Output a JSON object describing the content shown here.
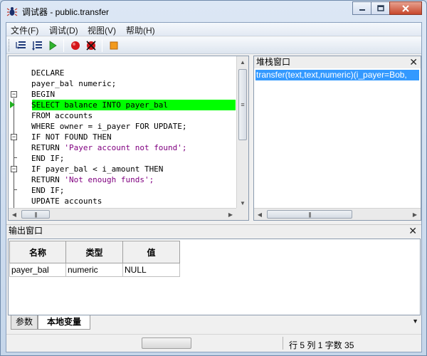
{
  "window": {
    "title": "调试器 - public.transfer",
    "minimize_icon": "minimize-icon",
    "maximize_icon": "maximize-icon",
    "close_icon": "close-icon"
  },
  "menu": [
    {
      "label": "文件(F)"
    },
    {
      "label": "调试(D)"
    },
    {
      "label": "视图(V)"
    },
    {
      "label": "帮助(H)"
    }
  ],
  "toolbar": [
    {
      "name": "step-into-icon"
    },
    {
      "name": "step-over-icon"
    },
    {
      "name": "continue-icon"
    },
    {
      "name": "set-breakpoint-icon"
    },
    {
      "name": "clear-breakpoints-icon"
    },
    {
      "name": "stop-icon"
    }
  ],
  "code": {
    "lines": [
      "DECLARE",
      "payer_bal numeric;",
      "BEGIN",
      "SELECT balance INTO payer_bal",
      "FROM accounts",
      "WHERE owner = i_payer FOR UPDATE;",
      "IF NOT FOUND THEN",
      "RETURN 'Payer account not found';",
      "END IF;",
      "IF payer_bal < i_amount THEN",
      "RETURN 'Not enough funds';",
      "END IF;",
      "UPDATE accounts"
    ],
    "current_line": 4
  },
  "stack": {
    "title": "堆栈窗口",
    "frames": [
      "transfer(text,text,numeric)(i_payer=Bob,"
    ]
  },
  "output": {
    "title": "输出窗口",
    "columns": [
      "名称",
      "类型",
      "值"
    ],
    "rows": [
      [
        "payer_bal",
        "numeric",
        "NULL"
      ]
    ],
    "tabs": [
      {
        "label": "参数",
        "active": false
      },
      {
        "label": "本地变量",
        "active": true
      }
    ]
  },
  "status": {
    "position": "行 5 列 1 字数 35"
  }
}
